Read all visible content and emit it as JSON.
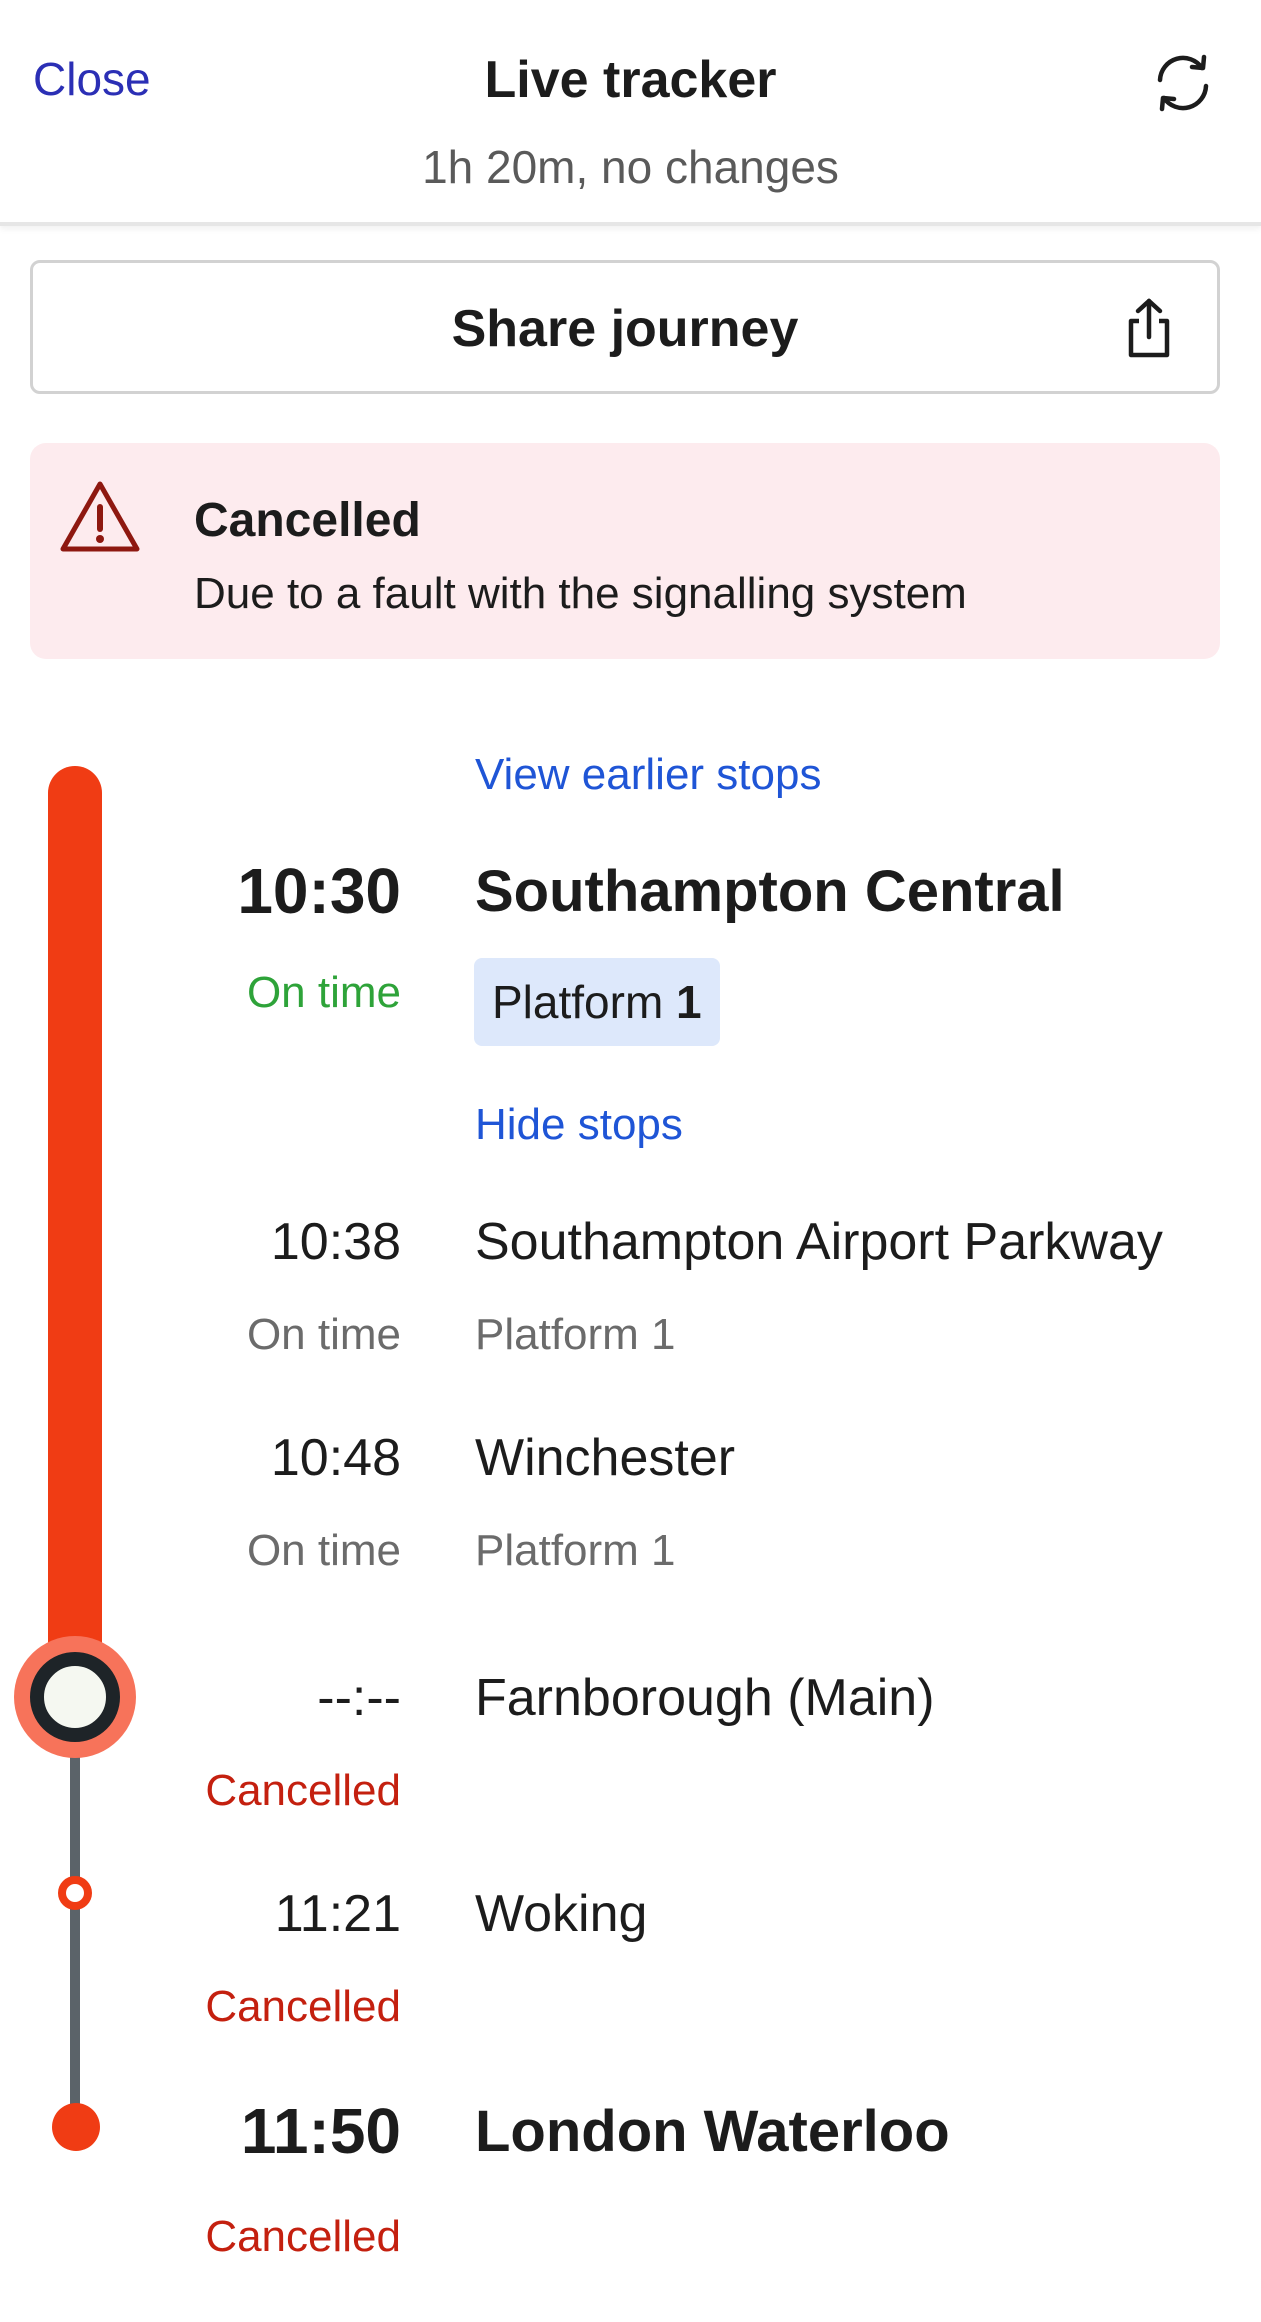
{
  "header": {
    "close_label": "Close",
    "title": "Live tracker",
    "subtitle": "1h 20m, no changes",
    "refresh_icon": "refresh-icon"
  },
  "share": {
    "label": "Share journey",
    "icon": "share-icon"
  },
  "alert": {
    "icon": "warning-icon",
    "title": "Cancelled",
    "message": "Due to a fault with the signalling system"
  },
  "timeline": {
    "view_earlier_label": "View earlier stops",
    "hide_stops_label": "Hide stops",
    "origin": {
      "time": "10:30",
      "station": "Southampton Central",
      "status": "On time",
      "platform_label": "Platform",
      "platform_number": "1"
    },
    "stops": [
      {
        "time": "10:38",
        "station": "Southampton Airport Parkway",
        "status": "On time",
        "platform": "Platform 1"
      },
      {
        "time": "10:48",
        "station": "Winchester",
        "status": "On time",
        "platform": "Platform 1"
      },
      {
        "time": "--:--",
        "station": "Farnborough (Main)",
        "status": "Cancelled",
        "platform": ""
      },
      {
        "time": "11:21",
        "station": "Woking",
        "status": "Cancelled",
        "platform": ""
      }
    ],
    "destination": {
      "time": "11:50",
      "station": "London Waterloo",
      "status": "Cancelled"
    }
  },
  "colors": {
    "accent_link": "#1f55d6",
    "close_link": "#2b2fb5",
    "track_red": "#f03c14",
    "on_time_green": "#2ea339",
    "cancelled_red": "#c4200f",
    "alert_bg": "#fdebee",
    "platform_badge_bg": "#dde8fb"
  }
}
